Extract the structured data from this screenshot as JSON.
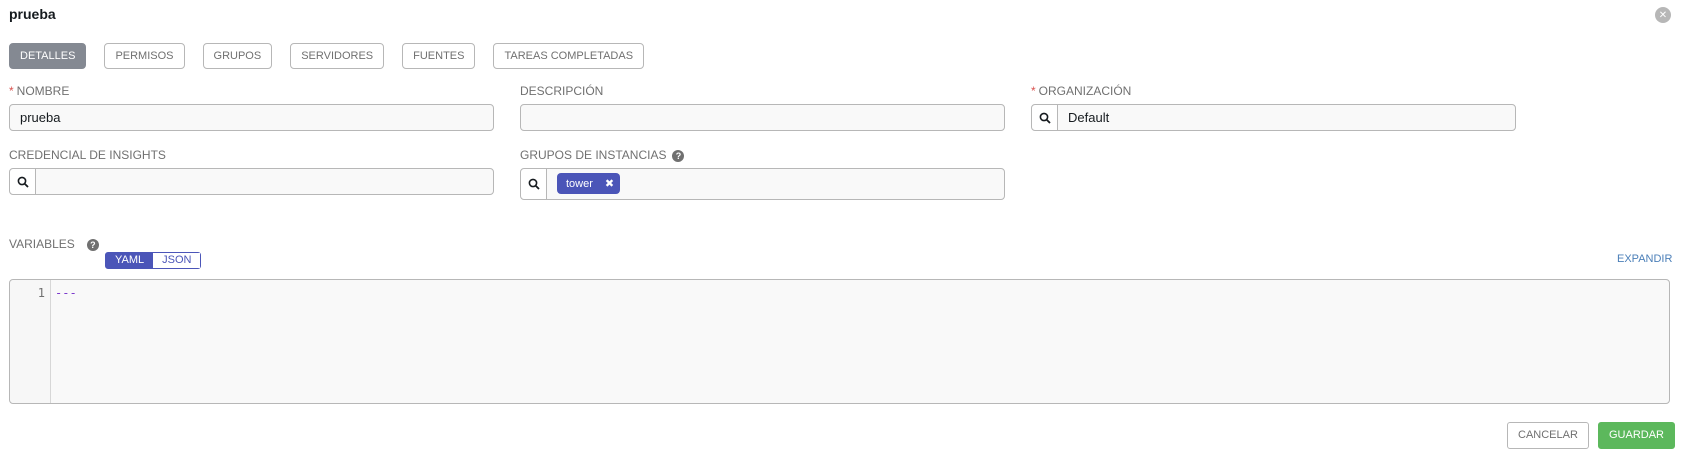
{
  "header": {
    "title": "prueba"
  },
  "tabs": [
    {
      "label": "DETALLES"
    },
    {
      "label": "PERMISOS"
    },
    {
      "label": "GRUPOS"
    },
    {
      "label": "SERVIDORES"
    },
    {
      "label": "FUENTES"
    },
    {
      "label": "TAREAS COMPLETADAS"
    }
  ],
  "form": {
    "name": {
      "label": "NOMBRE",
      "required": "*",
      "value": "prueba"
    },
    "description": {
      "label": "DESCRIPCIÓN",
      "value": ""
    },
    "organization": {
      "label": "ORGANIZACIÓN",
      "required": "*",
      "value": "Default"
    },
    "insights_credential": {
      "label": "CREDENCIAL DE INSIGHTS",
      "value": ""
    },
    "instance_groups": {
      "label": "GRUPOS DE INSTANCIAS",
      "help": "?",
      "tags": [
        "tower"
      ],
      "tag_close": "✖"
    },
    "variables": {
      "label": "VARIABLES",
      "help": "?",
      "modes": [
        "YAML",
        "JSON"
      ],
      "active_mode": "YAML",
      "expand_label": "EXPANDIR",
      "line_numbers": [
        "1"
      ],
      "code_lines": [
        "---"
      ]
    }
  },
  "actions": {
    "cancel_label": "CANCELAR",
    "save_label": "GUARDAR"
  },
  "icons": {
    "close": "close-icon",
    "search": "search-icon",
    "help": "help-icon"
  },
  "colors": {
    "accent": "#4b55b8",
    "save": "#5cb85c",
    "active_tab": "#848992",
    "required": "#d9534f"
  }
}
